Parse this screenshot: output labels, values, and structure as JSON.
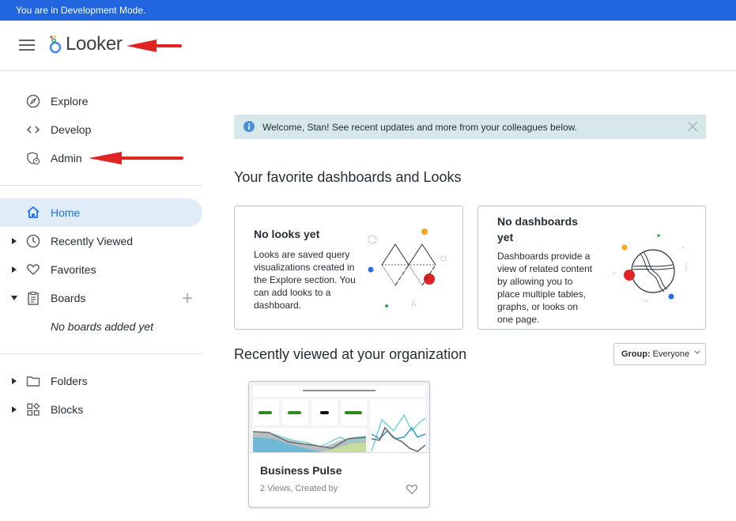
{
  "dev_banner": "You are in Development Mode.",
  "header": {
    "menu_icon": "hamburger-menu-icon",
    "app_name": "Looker",
    "logo_icon": "looker-logo-icon",
    "annotation_arrow_color": "#e02424"
  },
  "sidebar": {
    "top_items": [
      {
        "label": "Explore",
        "icon": "compass-icon"
      },
      {
        "label": "Develop",
        "icon": "code-brackets-icon"
      },
      {
        "label": "Admin",
        "icon": "shield-user-icon"
      }
    ],
    "main_items": [
      {
        "label": "Home",
        "icon": "home-icon",
        "active": true
      },
      {
        "label": "Recently Viewed",
        "icon": "clock-icon",
        "expandable": true
      },
      {
        "label": "Favorites",
        "icon": "heart-icon",
        "expandable": true
      },
      {
        "label": "Boards",
        "icon": "clipboard-icon",
        "expandable": true,
        "expanded": true
      }
    ],
    "boards_empty": "No boards added yet",
    "bottom_items": [
      {
        "label": "Folders",
        "icon": "folder-icon",
        "expandable": true
      },
      {
        "label": "Blocks",
        "icon": "blocks-icon",
        "expandable": true
      }
    ]
  },
  "main": {
    "welcome_banner": "Welcome, Stan! See recent updates and more from your colleagues below.",
    "favorites_heading": "Your favorite dashboards and Looks",
    "looks_card": {
      "title": "No looks yet",
      "description": "Looks are saved query visualizations created in the Explore section. You can add looks to a dashboard."
    },
    "dashboards_card": {
      "title": "No dashboards yet",
      "description": "Dashboards provide a view of related content by allowing you to place multiple tables, graphs, or looks on one page."
    },
    "recent_heading": "Recently viewed at your organization",
    "group_filter": {
      "label": "Group:",
      "value": "Everyone"
    },
    "recent_items": [
      {
        "name": "Business Pulse",
        "meta": "2 Views, Created by"
      }
    ]
  },
  "colors": {
    "dev_bar": "#2166de",
    "active_nav_bg": "#e1ecf9",
    "active_nav_text": "#1a73e8",
    "banner_bg": "#d6e8ea"
  }
}
